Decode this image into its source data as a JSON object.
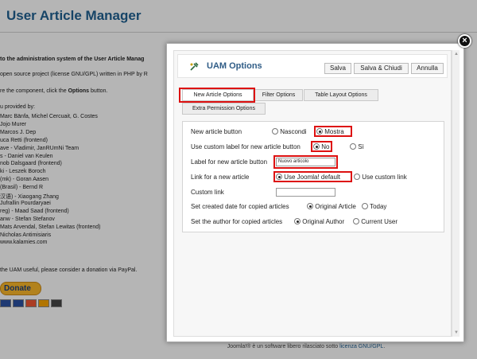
{
  "background": {
    "title": "User Article Manager",
    "line1": "to the administration system of the User Article Manag",
    "line2": "open source project (license GNU/GPL) written in PHP by R",
    "line3_prefix": "re the component, click the ",
    "line3_bold": "Options",
    "line3_suffix": " button.",
    "credits_heading": "u provided by:",
    "credits": [
      "Marc Bänfa, Michel Cercuait, G. Costes",
      "Jojo Murer",
      "Marcos J. Dep",
      "uca Retti (frontend)",
      "ave - Vladimir, JanRUmNi Team",
      "s - Daniel van Keulen",
      "nob Dalsgaard (frontend)",
      "ki - Leszek Boroch",
      "(mk) - Goran Aasen",
      "(Brasil) - Bernd R",
      "汉语) - Xiaogang Zhang",
      "Jufrallin Pourdaryaei",
      "reg) - Maad Saad (frontend)",
      "anw - Stefan Stefanov",
      "Mats Arvendal, Stefan Lewitas (frontend)",
      "Nicholas Antimisiaris",
      "www.kalamies.com"
    ],
    "donation_text": "the UAM useful, please consider a donation via PayPal.",
    "donate_label": "Donate",
    "footer_text": "Joomla!® è un software libero rilasciato sotto ",
    "footer_link": "licenza GNU/GPL",
    "footer_end": "."
  },
  "modal": {
    "close_label": "×",
    "title": "UAM Options",
    "toolbar": {
      "save": "Salva",
      "save_close": "Salva & Chiudi",
      "cancel": "Annulla"
    },
    "tabs": [
      "New Article Options",
      "Filter Options",
      "Table Layout Options",
      "Extra Permission Options"
    ],
    "form": {
      "new_article_button": {
        "label": "New article button",
        "opt1": "Nascondi",
        "opt2": "Mostra",
        "selected": "Mostra"
      },
      "custom_label": {
        "label": "Use custom label for new article button",
        "opt1": "No",
        "opt2": "Sì",
        "selected": "No"
      },
      "label_new_button": {
        "label": "Label for new article button",
        "value": "Nuovo articolo"
      },
      "link_new": {
        "label": "Link for a new article",
        "opt1": "Use Joomla! default",
        "opt2": "Use custom link",
        "selected": "Use Joomla! default"
      },
      "custom_link": {
        "label": "Custom link",
        "value": ""
      },
      "created_date": {
        "label": "Set created date for copied articles",
        "opt1": "Original Article",
        "opt2": "Today",
        "selected": "Original Article"
      },
      "author": {
        "label": "Set the author for copied articles",
        "opt1": "Original Author",
        "opt2": "Current User",
        "selected": "Original Author"
      }
    }
  },
  "colors": {
    "title_blue": "#1f5f8f",
    "highlight_red": "#dd1111",
    "donate_orange": "#f7b529"
  }
}
